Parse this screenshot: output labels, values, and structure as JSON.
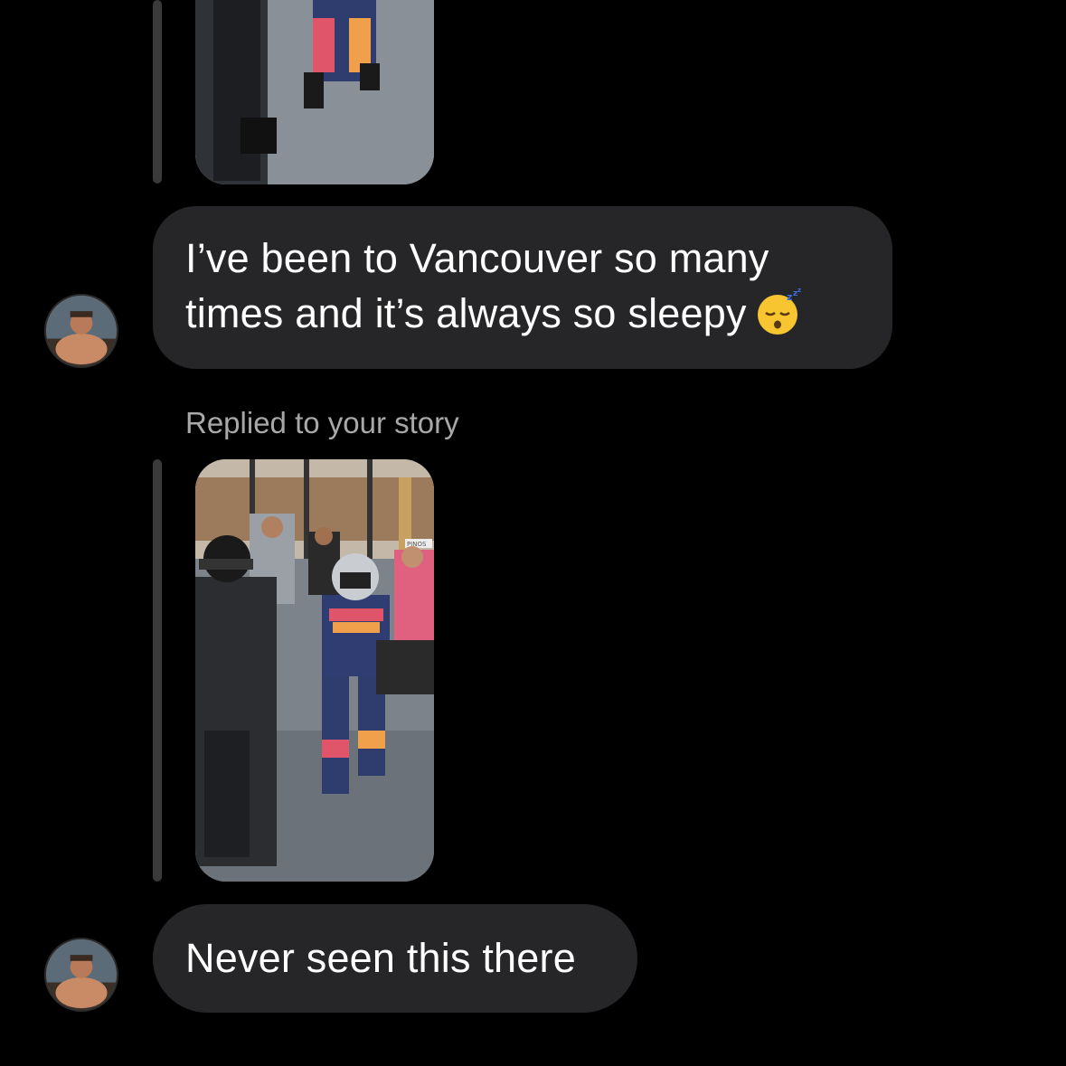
{
  "conversation": {
    "messages": [
      {
        "type": "text",
        "line1": "I’ve been to Vancouver so many",
        "line2": "times and it’s always so sleepy",
        "emoji": "sleeping-face"
      },
      {
        "type": "story_reply",
        "label": "Replied to your story"
      },
      {
        "type": "text",
        "text": "Never seen this there"
      }
    ]
  },
  "story_image": {
    "sign_text": "PINOS"
  },
  "colors": {
    "background": "#000000",
    "bubble": "#262628",
    "reply_bar": "#3a3a3c",
    "meta_text": "#a8a8a8"
  }
}
